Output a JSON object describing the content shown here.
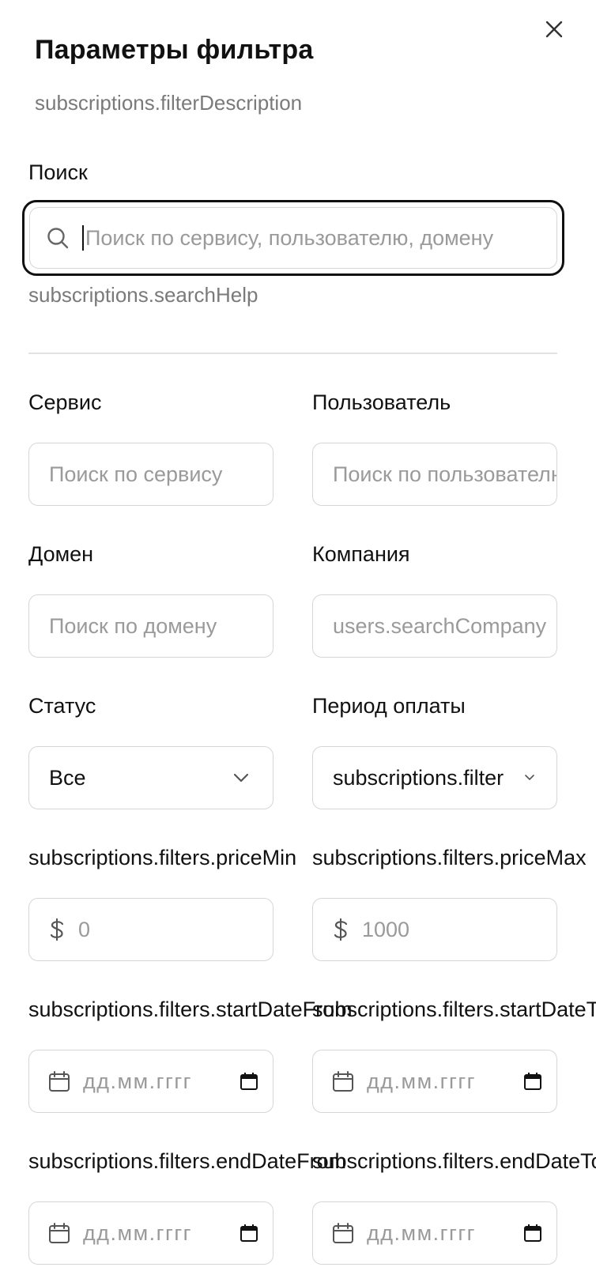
{
  "dialog": {
    "title": "Параметры фильтра",
    "description": "subscriptions.filterDescription"
  },
  "search": {
    "label": "Поиск",
    "placeholder": "Поиск по сервису, пользователю, домену",
    "help": "subscriptions.searchHelp"
  },
  "filters": {
    "service": {
      "label": "Сервис",
      "placeholder": "Поиск по сервису"
    },
    "user": {
      "label": "Пользователь",
      "placeholder": "Поиск по пользователю"
    },
    "domain": {
      "label": "Домен",
      "placeholder": "Поиск по домену"
    },
    "company": {
      "label": "Компания",
      "placeholder": "users.searchCompany"
    },
    "status": {
      "label": "Статус",
      "value": "Все"
    },
    "billing_period": {
      "label": "Период оплаты",
      "value": "subscriptions.filter"
    },
    "price_min": {
      "label": "subscriptions.filters.priceMin",
      "currency_symbol": "$",
      "placeholder": "0"
    },
    "price_max": {
      "label": "subscriptions.filters.priceMax",
      "currency_symbol": "$",
      "placeholder": "1000"
    },
    "start_date_from": {
      "label": "subscriptions.filters.startDateFrom",
      "placeholder": "дд.мм.гггг"
    },
    "start_date_to": {
      "label": "subscriptions.filters.startDateTo",
      "placeholder": "дд.мм.гггг"
    },
    "end_date_from": {
      "label": "subscriptions.filters.endDateFrom",
      "placeholder": "дд.мм.гггг"
    },
    "end_date_to": {
      "label": "subscriptions.filters.endDateTo",
      "placeholder": "дд.мм.гггг"
    }
  },
  "icons": {
    "close": "close-icon",
    "search": "search-icon",
    "chevron": "chevron-down-icon",
    "currency": "dollar-icon",
    "calendar": "calendar-icon"
  },
  "colors": {
    "text": "#111111",
    "muted": "#7a7a7a",
    "placeholder": "#9a9a9a",
    "border": "#d6d6d6",
    "focus_ring": "#111111"
  }
}
